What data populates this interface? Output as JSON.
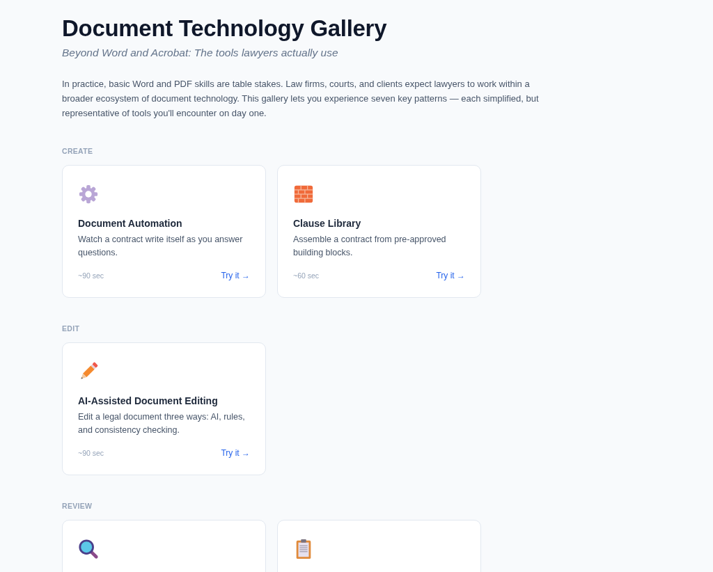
{
  "header": {
    "title": "Document Technology Gallery",
    "subtitle": "Beyond Word and Acrobat: The tools lawyers actually use",
    "intro": "In practice, basic Word and PDF skills are table stakes. Law firms, courts, and clients expect lawyers to work within a broader ecosystem of document technology. This gallery lets you experience seven key patterns — each simplified, but representative of tools you'll encounter on day one."
  },
  "sections": [
    {
      "label": "CREATE",
      "cards": [
        {
          "kind": "gear",
          "title": "Document Automation",
          "description": "Watch a contract write itself as you answer questions.",
          "duration": "~90 sec",
          "link": "Try it →"
        },
        {
          "kind": "bricks",
          "title": "Clause Library",
          "description": "Assemble a contract from pre-approved building blocks.",
          "duration": "~60 sec",
          "link": "Try it →"
        }
      ]
    },
    {
      "label": "EDIT",
      "cards": [
        {
          "kind": "pencil",
          "title": "AI-Assisted Document Editing",
          "description": "Edit a legal document three ways: AI, rules, and consistency checking.",
          "duration": "~90 sec",
          "link": "Try it →"
        }
      ]
    },
    {
      "label": "REVIEW",
      "cards": [
        {
          "kind": "magnifier"
        },
        {
          "kind": "clipboard"
        }
      ]
    }
  ]
}
